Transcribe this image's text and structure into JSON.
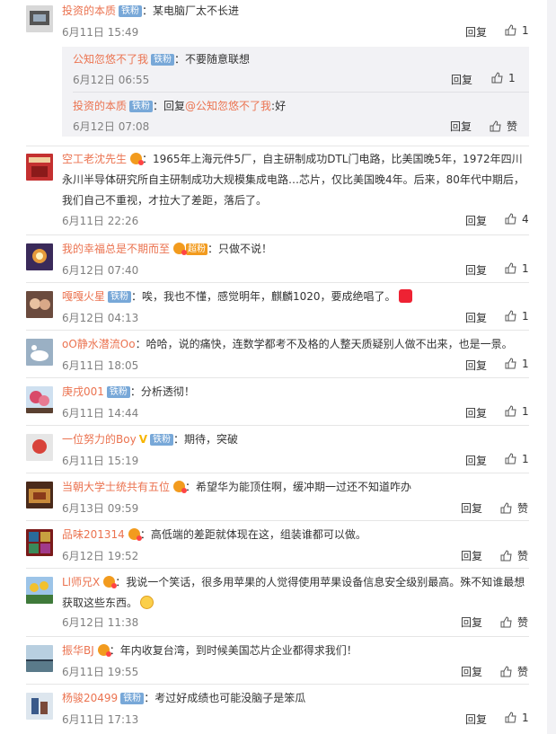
{
  "labels": {
    "reply": "回复",
    "like_zero": "赞",
    "superfan": "超粉"
  },
  "colors": {
    "username": "#eb7350",
    "badge": "#78a8d8",
    "meta": "#808080",
    "subbg": "#f2f2f5"
  },
  "comments": [
    {
      "user": "投资的本质",
      "badge": "铁粉",
      "text": "：某电脑厂太不长进",
      "date": "6月11日 15:49",
      "likes": "1",
      "replies": [
        {
          "user": "公知忽悠不了我",
          "badge": "铁粉",
          "text": "：不要随意联想",
          "date": "6月12日 06:55",
          "likes": "1"
        },
        {
          "user": "投资的本质",
          "badge": "铁粉",
          "prefix": "：回复",
          "at": "@公知忽悠不了我",
          "text": ":好",
          "date": "6月12日 07:08",
          "likes": "赞"
        }
      ]
    },
    {
      "user": "空工老沈先生",
      "text": "：1965年上海元件5厂，自主研制成功DTL门电路，比美国晚5年，1972年四川永川半导体研究所自主研制成功大规模集成电路…芯片，仅比美国晚4年。后来，80年代中期后，我们自己不重视，才拉大了差距，落后了。",
      "date": "6月11日 22:26",
      "likes": "4"
    },
    {
      "user": "我的幸福总是不期而至",
      "text": "：只做不说！",
      "date": "6月12日 07:40",
      "likes": "1"
    },
    {
      "user": "嘎嘎火星",
      "badge": "铁粉",
      "text": "：唉，我也不懂，感觉明年，麒麟1020，要成绝唱了。",
      "date": "6月12日 04:13",
      "likes": "1"
    },
    {
      "user": "oO静水潜流Oo",
      "text": "：哈哈，说的痛快，连数学都考不及格的人整天质疑别人做不出来，也是一景。",
      "date": "6月11日 18:05",
      "likes": "1"
    },
    {
      "user": "庚戌001",
      "badge": "铁粉",
      "text": "：分析透彻！",
      "date": "6月11日 14:44",
      "likes": "1"
    },
    {
      "user": "一位努力的Boy",
      "badge": "铁粉",
      "text": "：期待，突破",
      "date": "6月11日 15:19",
      "likes": "1"
    },
    {
      "user": "当朝大学士统共有五位",
      "text": "：希望华为能顶住啊，缓冲期一过还不知道咋办",
      "date": "6月13日 09:59",
      "likes": "赞"
    },
    {
      "user": "品味201314",
      "text": "：高低端的差距就体现在这，组装谁都可以做。",
      "date": "6月12日 19:52",
      "likes": "赞"
    },
    {
      "user": "Ll师兄X",
      "text": "：我说一个笑话，很多用苹果的人觉得使用苹果设备信息安全级别最高。殊不知谁最想获取这些东西。",
      "date": "6月12日 11:38",
      "likes": "赞"
    },
    {
      "user": "振华BJ",
      "text": "：年内收复台湾，到时候美国芯片企业都得求我们！",
      "date": "6月11日 19:55",
      "likes": "赞"
    },
    {
      "user": "杨骏20499",
      "badge": "铁粉",
      "text": "：考过好成绩也可能没脑子是笨瓜",
      "date": "6月11日 17:13",
      "likes": "1"
    }
  ]
}
